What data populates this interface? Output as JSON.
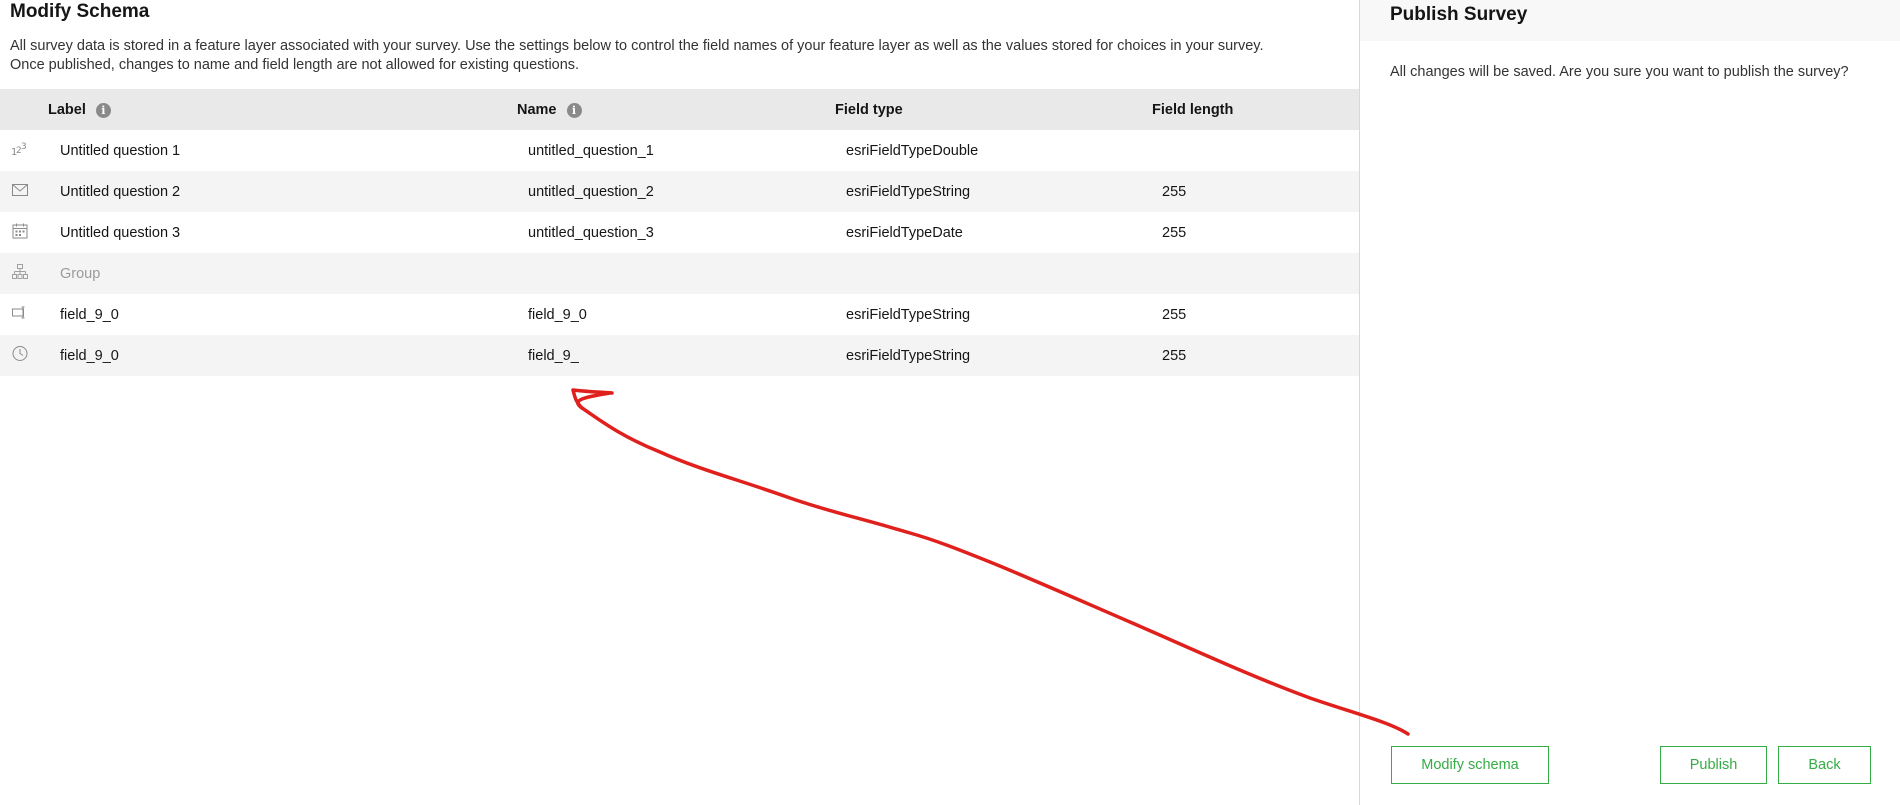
{
  "schema": {
    "title": "Modify Schema",
    "description": "All survey data is stored in a feature layer associated with your survey. Use the settings below to control the field names of your feature layer as well as the values stored for choices in your survey. Once published, changes to name and field length are not allowed for existing questions.",
    "columns": {
      "label": "Label",
      "name": "Name",
      "field_type": "Field type",
      "field_length": "Field length"
    },
    "rows": [
      {
        "icon": "number-icon",
        "label": "Untitled question 1",
        "name": "untitled_question_1",
        "field_type": "esriFieldTypeDouble",
        "field_length": ""
      },
      {
        "icon": "email-icon",
        "label": "Untitled question 2",
        "name": "untitled_question_2",
        "field_type": "esriFieldTypeString",
        "field_length": "255"
      },
      {
        "icon": "calendar-icon",
        "label": "Untitled question 3",
        "name": "untitled_question_3",
        "field_type": "esriFieldTypeDate",
        "field_length": "255"
      },
      {
        "icon": "group-icon",
        "label": "Group",
        "name": "",
        "field_type": "",
        "field_length": ""
      },
      {
        "icon": "text-input-icon",
        "label": "field_9_0",
        "name": "field_9_0",
        "field_type": "esriFieldTypeString",
        "field_length": "255"
      },
      {
        "icon": "clock-icon",
        "label": "field_9_0",
        "name": "field_9_",
        "field_type": "esriFieldTypeString",
        "field_length": "255"
      }
    ]
  },
  "publish": {
    "title": "Publish Survey",
    "message": "All changes will be saved. Are you sure you want to publish the survey?",
    "modify_label": "Modify schema",
    "publish_label": "Publish",
    "back_label": "Back"
  },
  "colors": {
    "accent": "#35ac46",
    "header_bg": "#e9e9e9",
    "annotation": "#e0201c"
  }
}
